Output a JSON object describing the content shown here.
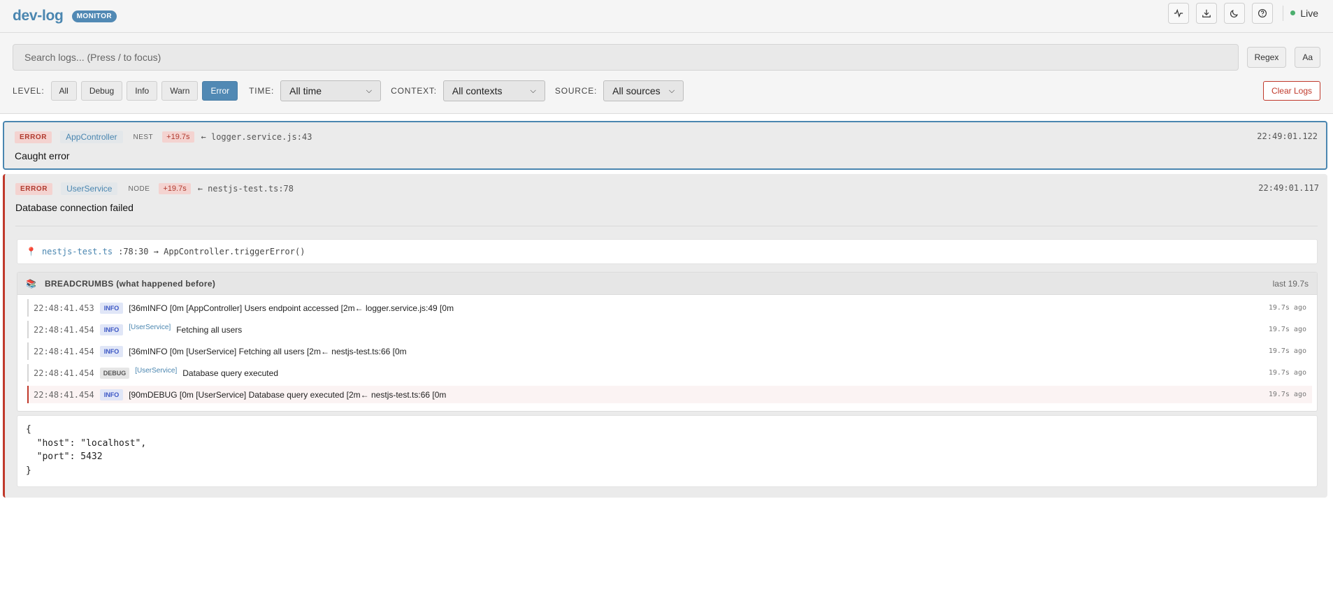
{
  "header": {
    "brand": "dev-log",
    "badge": "MONITOR",
    "actions": [
      "activity-icon",
      "download-icon",
      "moon-icon",
      "help-icon"
    ],
    "live_label": "Live"
  },
  "filters": {
    "search_placeholder": "Search logs... (Press / to focus)",
    "regex_label": "Regex",
    "case_label": "Aa",
    "level_label": "LEVEL:",
    "levels": [
      "All",
      "Debug",
      "Info",
      "Warn",
      "Error"
    ],
    "active_level": "Error",
    "time_label": "TIME:",
    "time_value": "All time",
    "context_label": "CONTEXT:",
    "context_value": "All contexts",
    "source_label": "SOURCE:",
    "source_value": "All sources",
    "clear_label": "Clear Logs"
  },
  "logs": [
    {
      "level": "ERROR",
      "context": "AppController",
      "source": "NEST",
      "delta": "+19.7s",
      "location": "← logger.service.js:43",
      "timestamp": "22:49:01.122",
      "message": "Caught error"
    },
    {
      "level": "ERROR",
      "context": "UserService",
      "source": "NODE",
      "delta": "+19.7s",
      "location": "← nestjs-test.ts:78",
      "timestamp": "22:49:01.117",
      "message": "Database connection failed",
      "stack": {
        "file": "nestjs-test.ts",
        "position": ":78:30 → AppController.triggerError()"
      },
      "breadcrumbs": {
        "title": "BREADCRUMBS (what happened before)",
        "last": "last 19.7s",
        "rows": [
          {
            "time": "22:48:41.453",
            "level": "INFO",
            "ctx": "",
            "message": "[36mINFO  [0m [AppController] Users endpoint accessed  [2m← logger.service.js:49 [0m",
            "ago": "19.7s ago"
          },
          {
            "time": "22:48:41.454",
            "level": "INFO",
            "ctx": "[UserService]",
            "message": "Fetching all users",
            "ago": "19.7s ago"
          },
          {
            "time": "22:48:41.454",
            "level": "INFO",
            "ctx": "",
            "message": "[36mINFO  [0m [UserService] Fetching all users  [2m← nestjs-test.ts:66 [0m",
            "ago": "19.7s ago"
          },
          {
            "time": "22:48:41.454",
            "level": "DEBUG",
            "ctx": "[UserService]",
            "message": "Database query executed",
            "ago": "19.7s ago"
          },
          {
            "time": "22:48:41.454",
            "level": "INFO",
            "ctx": "",
            "message": "[90mDEBUG [0m [UserService] Database query executed  [2m← nestjs-test.ts:66 [0m",
            "ago": "19.7s ago"
          }
        ]
      },
      "json": "{\n  \"host\": \"localhost\",\n  \"port\": 5432\n}"
    }
  ],
  "colors": {
    "accent": "#4a86b0",
    "error": "#c0392b",
    "live": "#4caf6e"
  }
}
